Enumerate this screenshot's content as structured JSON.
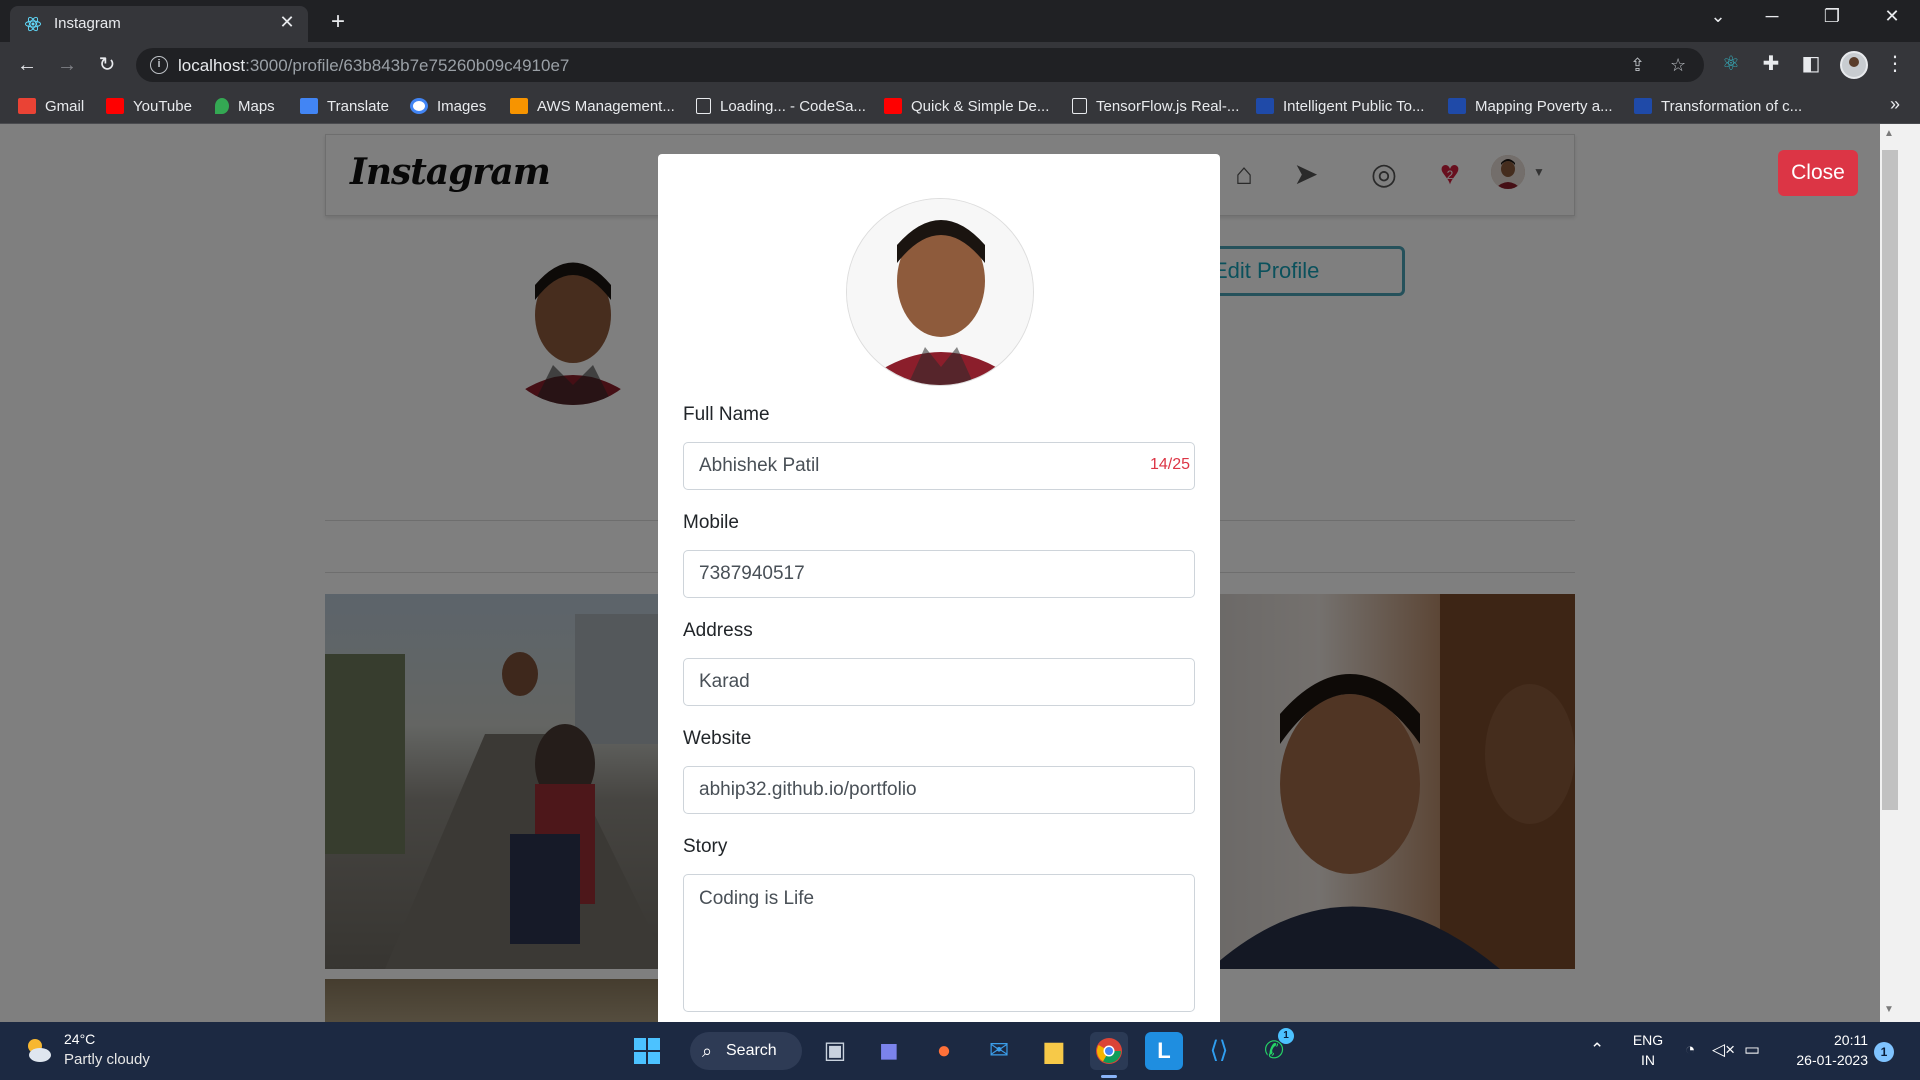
{
  "browser": {
    "tab_title": "Instagram",
    "tab_close": "✕",
    "new_tab": "+",
    "url_host": "localhost",
    "url_rest": ":3000/profile/63b843b7e75260b09c4910e7",
    "bookmarks": [
      {
        "label": "Gmail",
        "color": "#ea4335"
      },
      {
        "label": "YouTube",
        "color": "#ff0000"
      },
      {
        "label": "Maps",
        "color": "#34a853"
      },
      {
        "label": "Translate",
        "color": "#4285f4"
      },
      {
        "label": "Images",
        "color": "#ffffff"
      },
      {
        "label": "AWS Management...",
        "color": "#f79400"
      },
      {
        "label": "Loading... - CodeSa...",
        "color": "transparent"
      },
      {
        "label": "Quick & Simple De...",
        "color": "#ff0000"
      },
      {
        "label": "TensorFlow.js Real-...",
        "color": "transparent"
      },
      {
        "label": "Intelligent Public To...",
        "color": "#1f4aa8"
      },
      {
        "label": "Mapping Poverty a...",
        "color": "#1f4aa8"
      },
      {
        "label": "Transformation of c...",
        "color": "#1f4aa8"
      }
    ],
    "bookmarks_more": "»"
  },
  "instagram": {
    "logo": "Instagram",
    "notification_count": "2",
    "edit_profile_label": "Edit Profile",
    "close_label": "Close"
  },
  "modal": {
    "fields": {
      "full_name": {
        "label": "Full Name",
        "value": "Abhishek Patil",
        "count": "14/25"
      },
      "mobile": {
        "label": "Mobile",
        "value": "7387940517"
      },
      "address": {
        "label": "Address",
        "value": "Karad"
      },
      "website": {
        "label": "Website",
        "value": "abhip32.github.io/portfolio"
      },
      "story": {
        "label": "Story",
        "value": "Coding is Life"
      }
    }
  },
  "taskbar": {
    "temperature": "24°C",
    "weather": "Partly cloudy",
    "search_label": "Search",
    "lang_line1": "ENG",
    "lang_line2": "IN",
    "time": "20:11",
    "date": "26-01-2023",
    "notifications": "1",
    "whatsapp_badge": "1"
  },
  "colors": {
    "accent_danger": "#dc3545",
    "accent_info": "#17a2b8",
    "heart": "#d11f3c"
  }
}
